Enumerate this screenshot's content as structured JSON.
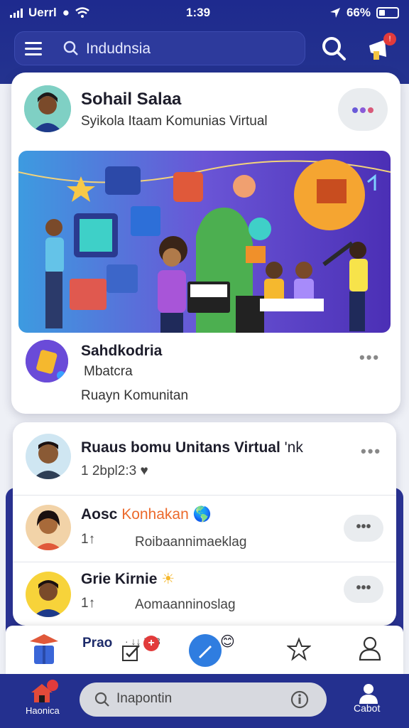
{
  "status": {
    "carrier": "Uerrl",
    "time": "1:39",
    "battery": "66%"
  },
  "header": {
    "search_text": "Indudnsia"
  },
  "post": {
    "author": "Sohail Salaa",
    "subtitle": "Syikola  Itaam Komunias Virtual",
    "community_name": "Sahdkodria",
    "community_sub": "Mbatcra",
    "community_desc": "Ruayn Komunitan"
  },
  "feed": [
    {
      "title": "Ruaus bomu Unitans Virtual ",
      "title_tail": "'nk",
      "meta": "1 2bpl2:3 ♥"
    },
    {
      "title": "Aosc ",
      "title_accent": "Konhakan",
      "meta": "1↑",
      "detail": "Roibaannimaeklag"
    },
    {
      "title": "Grie Kirnie",
      "meta": "1↑",
      "detail": "Aomaanninoslag"
    }
  ],
  "action_bar": {
    "label": "Prao",
    "extra": "· ↓↓ ’·43"
  },
  "bottom_nav": {
    "home_label": "Haonica",
    "search_placeholder": "Inapontin",
    "profile_label": "Cabot"
  },
  "colors": {
    "brand": "#24308f",
    "accent": "#ec6a2c",
    "badge": "#e23b3b"
  },
  "dots": "•••"
}
